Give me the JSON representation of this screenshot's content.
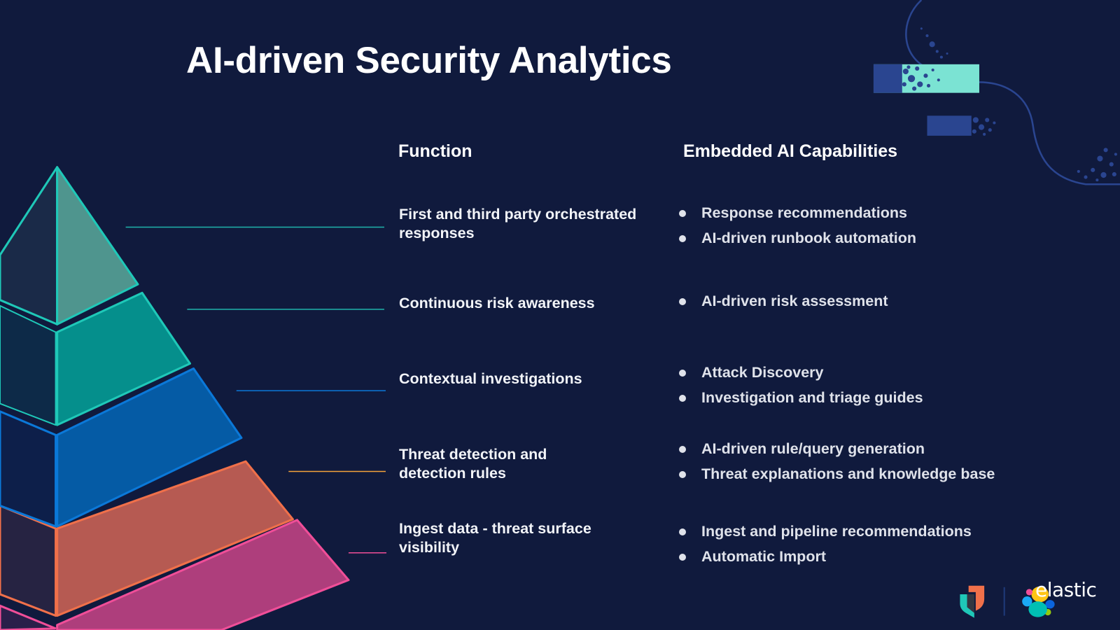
{
  "title": "AI-driven Security Analytics",
  "columns": {
    "function": "Function",
    "capabilities": "Embedded AI Capabilities"
  },
  "tiers": [
    {
      "function": "First and third party orchestrated responses",
      "function_lines": [
        "First and third party orchestrated",
        "responses"
      ],
      "capabilities": [
        "Response recommendations",
        "AI-driven runbook automation"
      ],
      "color": "#1fc8b8",
      "fill_front": "#4f958e",
      "fill_side": "#1a2a48"
    },
    {
      "function": "Continuous risk awareness",
      "function_lines": [
        "Continuous risk awareness"
      ],
      "capabilities": [
        "AI-driven risk assessment"
      ],
      "color": "#1fc8b8",
      "fill_front": "#058f8c",
      "fill_side": "#0d2a48"
    },
    {
      "function": "Contextual investigations",
      "function_lines": [
        "Contextual investigations"
      ],
      "capabilities": [
        "Attack Discovery",
        "Investigation and triage guides"
      ],
      "color": "#0b78d8",
      "fill_front": "#055ba5",
      "fill_side": "#0d1f4a"
    },
    {
      "function": "Threat detection and detection rules",
      "function_lines": [
        "Threat detection and",
        "detection rules"
      ],
      "capabilities": [
        "AI-driven rule/query generation",
        "Threat explanations and knowledge base"
      ],
      "color": "#f0704a",
      "line_color": "#f5a43a",
      "fill_front": "#b65a52",
      "fill_side": "#262342"
    },
    {
      "function": "Ingest data - threat surface visibility",
      "function_lines": [
        "Ingest data - threat surface",
        "visibility"
      ],
      "capabilities": [
        "Ingest and pipeline recommendations",
        "Automatic Import"
      ],
      "color": "#f04e98",
      "fill_front": "#ae3e7c",
      "fill_side": "#2a1f4a"
    }
  ],
  "logos": {
    "security_icon": "elastic-security-shield-icon",
    "elastic_icon": "elastic-cluster-icon",
    "elastic_wordmark": "elastic"
  },
  "colors": {
    "background": "#101a3d",
    "decor_teal": "#7be3d3",
    "decor_blue": "#2a4590"
  }
}
